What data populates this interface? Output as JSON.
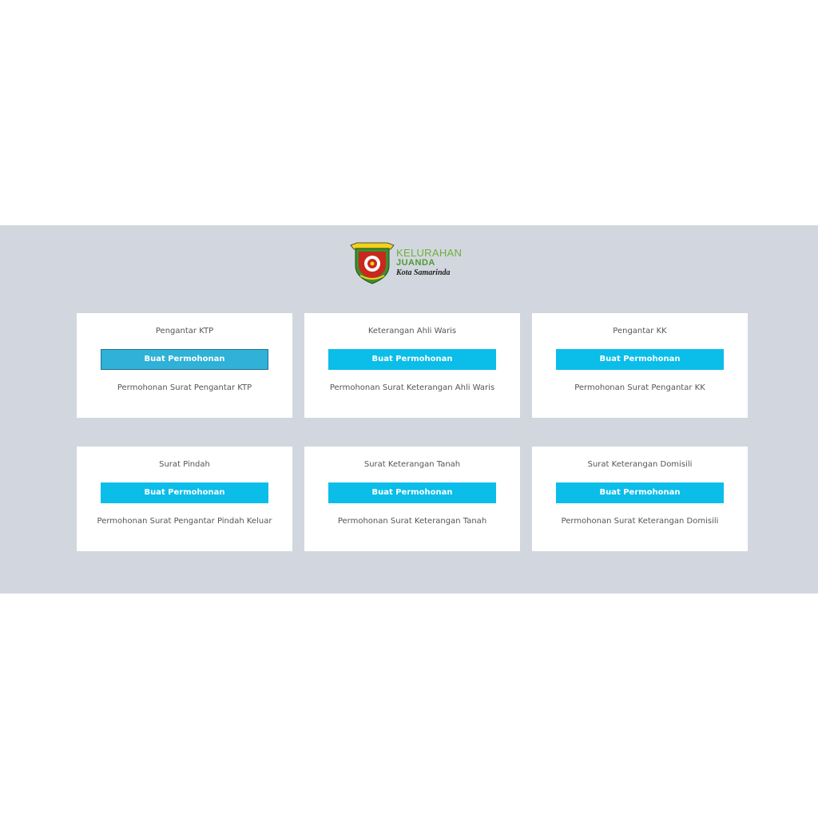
{
  "logo": {
    "line1": "KELURAHAN",
    "line2": "JUANDA",
    "line3": "Kota Samarinda",
    "colors": {
      "green": "#6fae3f",
      "dark_green": "#4f9a33",
      "emblem_red": "#c8281e",
      "emblem_yellow": "#f2d21b"
    }
  },
  "colors": {
    "band_background": "#d2d7df",
    "button": "#0bbde9",
    "button_focused": "#2fb1d8",
    "card_text": "#555555"
  },
  "services": [
    {
      "title": "Pengantar KTP",
      "button_label": "Buat Permohonan",
      "description": "Permohonan Surat Pengantar KTP",
      "focused": true
    },
    {
      "title": "Keterangan Ahli Waris",
      "button_label": "Buat Permohonan",
      "description": "Permohonan Surat Keterangan Ahli Waris",
      "focused": false
    },
    {
      "title": "Pengantar KK",
      "button_label": "Buat Permohonan",
      "description": "Permohonan Surat Pengantar KK",
      "focused": false
    },
    {
      "title": "Surat Pindah",
      "button_label": "Buat Permohonan",
      "description": "Permohonan Surat Pengantar Pindah Keluar",
      "focused": false
    },
    {
      "title": "Surat Keterangan Tanah",
      "button_label": "Buat Permohonan",
      "description": "Permohonan Surat Keterangan Tanah",
      "focused": false
    },
    {
      "title": "Surat Keterangan Domisili",
      "button_label": "Buat Permohonan",
      "description": "Permohonan Surat Keterangan Domisili",
      "focused": false
    }
  ]
}
